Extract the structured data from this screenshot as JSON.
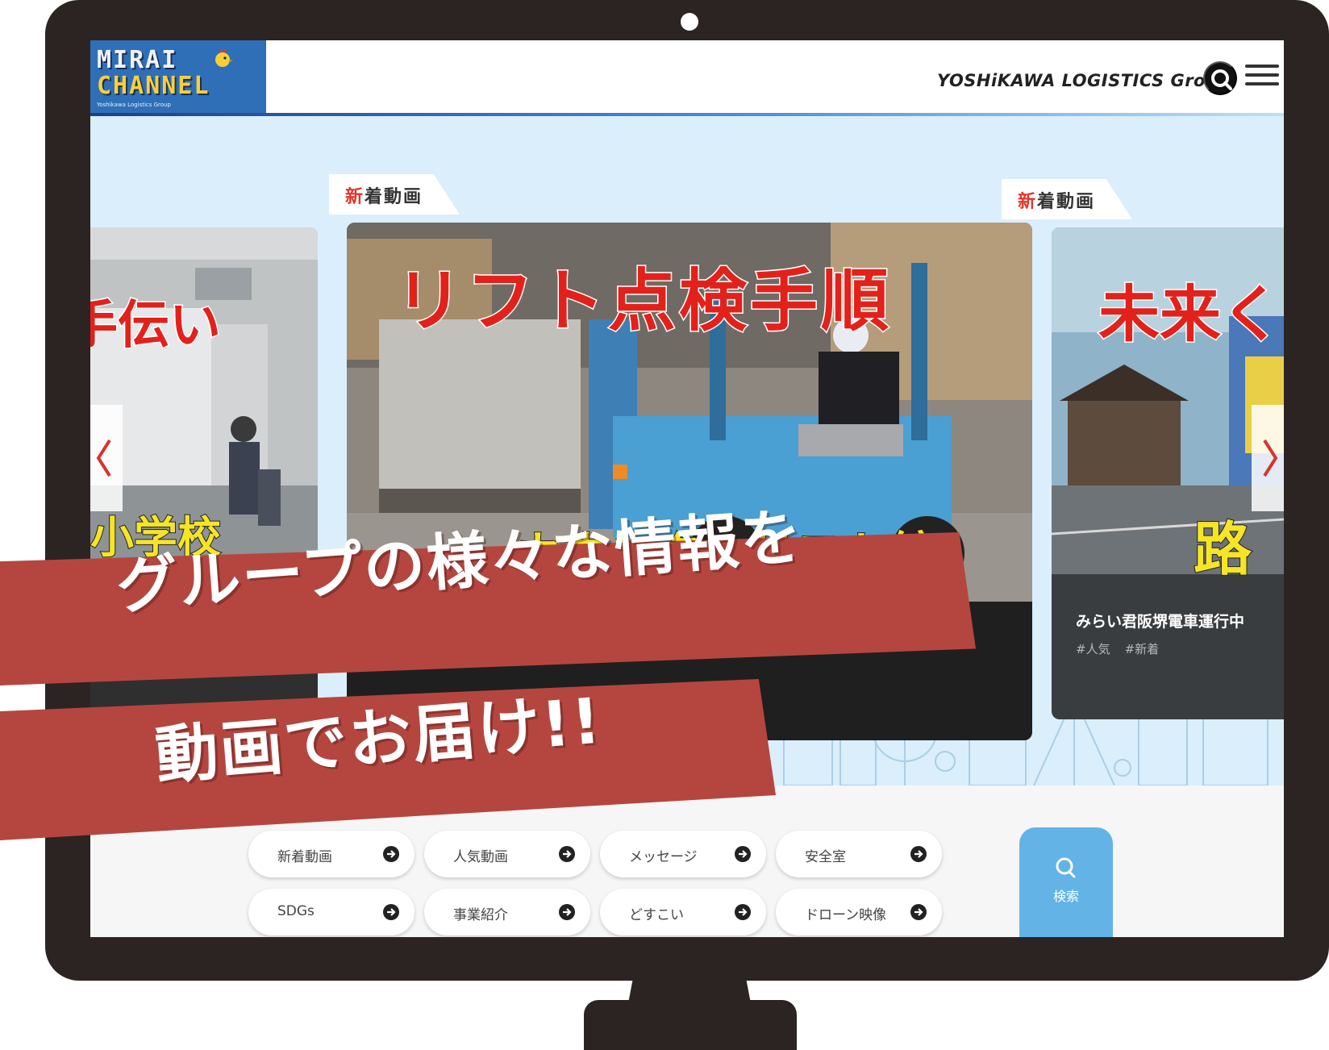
{
  "site": {
    "logo_line1": "MIRAI",
    "logo_line2": "CHANNEL",
    "logo_sub": "Yoshikawa Logistics Group",
    "brand": "YOSHiKAWA LOGISTICS Group"
  },
  "carousel": {
    "left_card": {
      "overlay_top": "手伝い",
      "overlay_bottom": "小学校"
    },
    "center_card": {
      "ribbon_first": "新",
      "ribbon_rest": "着動画",
      "overlay_top": "リフト点検手順",
      "overlay_bottom": "カウンターリフト編"
    },
    "right_card": {
      "ribbon_first": "新",
      "ribbon_rest": "着動画",
      "overlay_top": "未来く",
      "overlay_bottom": "路",
      "title": "みらい君阪堺電車運行中",
      "tags": [
        "#人気",
        "#新着"
      ]
    }
  },
  "categories": [
    {
      "label": "新着動画"
    },
    {
      "label": "人気動画"
    },
    {
      "label": "メッセージ"
    },
    {
      "label": "安全室"
    },
    {
      "label": "SDGs"
    },
    {
      "label": "事業紹介"
    },
    {
      "label": "どすこい"
    },
    {
      "label": "ドローン映像"
    }
  ],
  "search_tile": {
    "label": "検索"
  },
  "banners": {
    "line1": "グループの様々な情報を",
    "line2": "動画でお届け!!"
  },
  "colors": {
    "bezel": "#2b2422",
    "banner": "#b5463f",
    "ribbon_accent": "#e2362b",
    "search_tile": "#64b3e6"
  }
}
